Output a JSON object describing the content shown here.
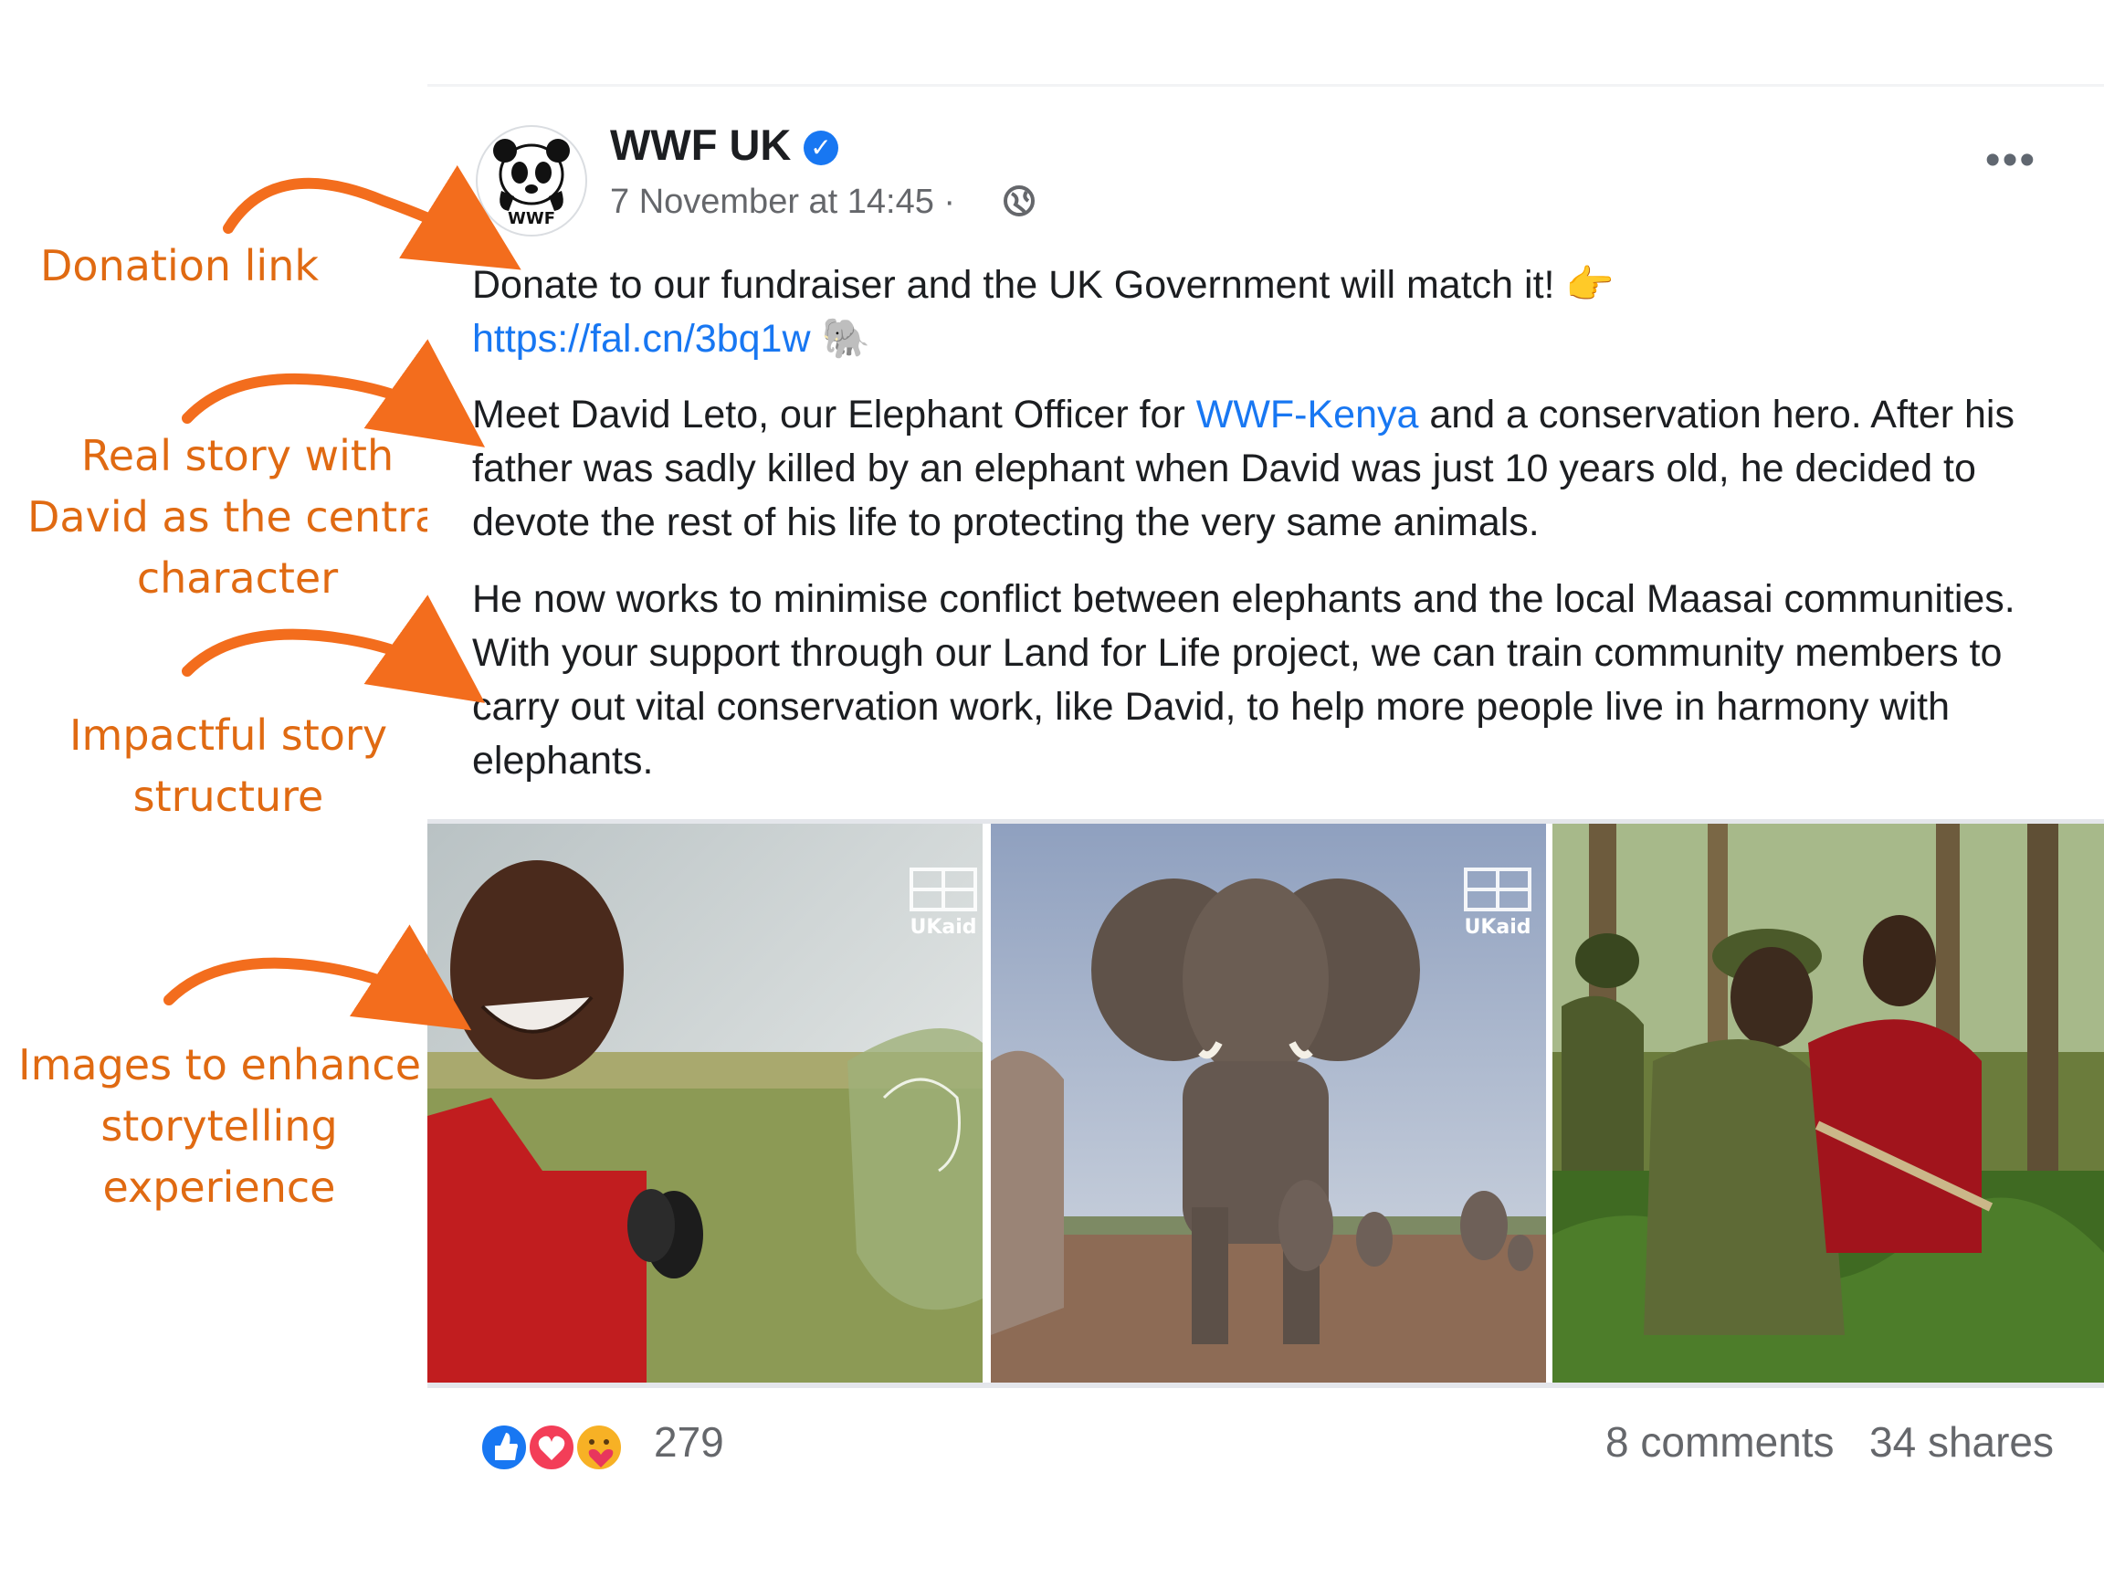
{
  "annotations": [
    {
      "lines": [
        "Donation link"
      ]
    },
    {
      "lines": [
        "Real story with",
        "David as the central",
        "character"
      ]
    },
    {
      "lines": [
        "Impactful story",
        "structure"
      ]
    },
    {
      "lines": [
        "Images to enhance",
        "storytelling",
        "experience"
      ]
    }
  ],
  "post": {
    "page_name": "WWF UK",
    "avatar_logo_text": "WWF",
    "timestamp": "7 November at 14:45 ·",
    "paragraph1": {
      "text": "Donate to our fundraiser and the UK Government will match it!",
      "emoji_after": "👉",
      "link": "https://fal.cn/3bq1w",
      "emoji_after_link": "🐘"
    },
    "paragraph2": {
      "before_link": "Meet David Leto, our Elephant Officer for ",
      "link": "WWF-Kenya",
      "after_link": " and a conservation hero. After his father was sadly killed by an elephant when David was just 10 years old, he decided to devote the rest of his life to protecting the very same animals."
    },
    "paragraph3": "He now works to minimise conflict between elephants and the local Maasai communities. With your support through our Land for Life project, we can train community members to carry out vital conservation work, like David, to help more people live in harmony with elephants.",
    "photos": [
      {
        "subject": "man-with-binoculars",
        "badge": "UKaid"
      },
      {
        "subject": "elephant-herd",
        "badge": "UKaid"
      },
      {
        "subject": "rangers-in-forest"
      }
    ],
    "reaction_count": "279",
    "comments": "8 comments",
    "shares": "34 shares"
  },
  "colors": {
    "annotation": "#e06a12",
    "link": "#1877f2",
    "meta": "#65676b"
  },
  "icons": [
    "verified-badge-icon",
    "globe-icon",
    "more-options-icon",
    "like-reaction-icon",
    "love-reaction-icon",
    "care-reaction-icon"
  ]
}
